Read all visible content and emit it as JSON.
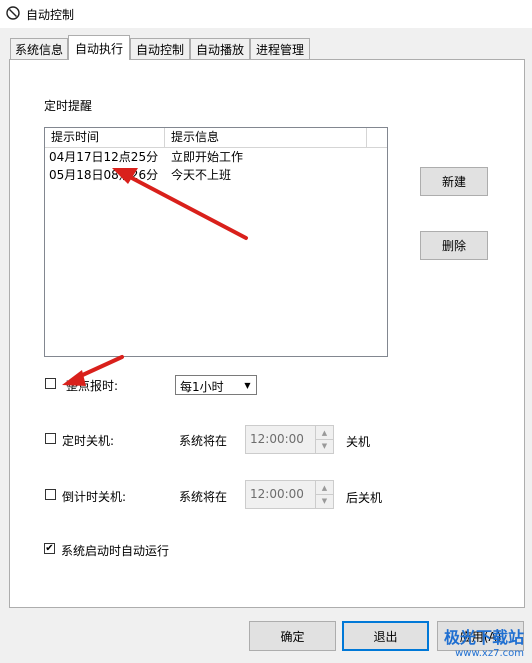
{
  "window": {
    "title": "自动控制"
  },
  "tabs": [
    {
      "label": "系统信息"
    },
    {
      "label": "自动执行"
    },
    {
      "label": "自动控制"
    },
    {
      "label": "自动播放"
    },
    {
      "label": "进程管理"
    }
  ],
  "reminder": {
    "group_label": "定时提醒",
    "columns": [
      "提示时间",
      "提示信息"
    ],
    "rows": [
      {
        "time": "04月17日12点25分",
        "message": "立即开始工作"
      },
      {
        "time": "05月18日08点26分",
        "message": "今天不上班"
      }
    ],
    "new_button": "新建",
    "delete_button": "删除"
  },
  "hourly": {
    "label": "整点报时:",
    "checked": false,
    "select_value": "每1小时"
  },
  "scheduled_shutdown": {
    "label": "定时关机:",
    "prefix": "系统将在",
    "time": "12:00:00",
    "suffix": "关机",
    "checked": false
  },
  "countdown_shutdown": {
    "label": "倒计时关机:",
    "prefix": "系统将在",
    "time": "12:00:00",
    "suffix": "后关机",
    "checked": false
  },
  "autorun": {
    "label": "系统启动时自动运行",
    "checked": true,
    "check_mark": "✔"
  },
  "footer": {
    "ok_button": "确定",
    "exit_button": "退出",
    "apply_button": "应用(A)"
  },
  "watermark": {
    "main": "极光下载站",
    "sub": "www.xz7.com"
  },
  "colors": {
    "arrow": "#d9201b",
    "accent": "#0078d7"
  }
}
